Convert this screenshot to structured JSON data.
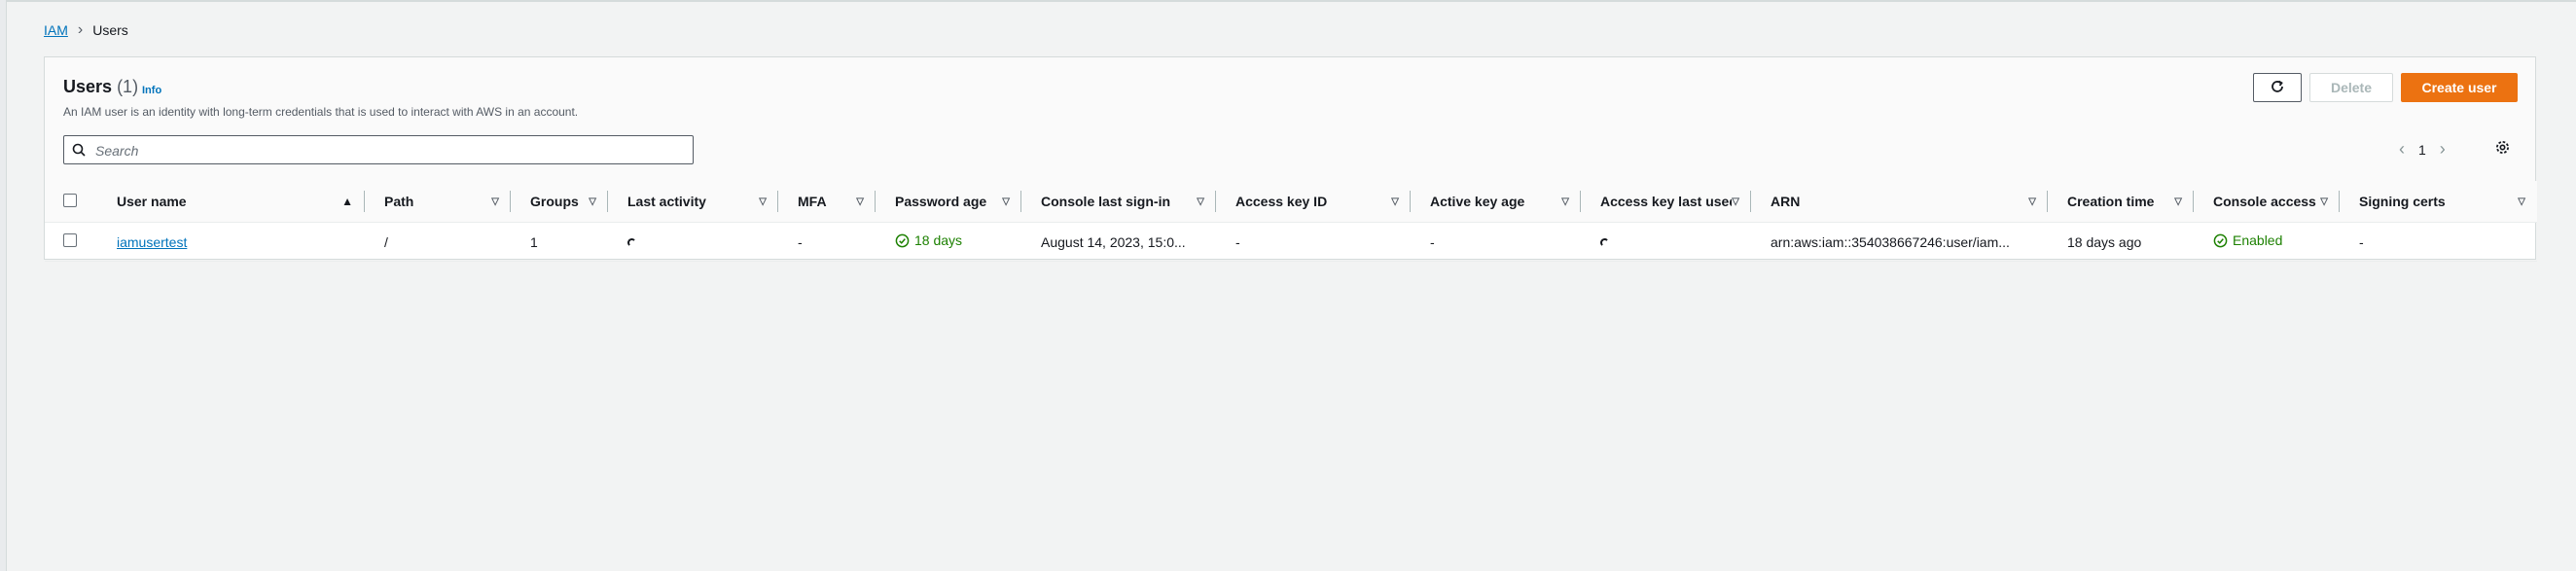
{
  "breadcrumb": {
    "root": "IAM",
    "current": "Users"
  },
  "panel": {
    "title": "Users",
    "count": "(1)",
    "info": "Info",
    "description": "An IAM user is an identity with long-term credentials that is used to interact with AWS in an account."
  },
  "search": {
    "placeholder": "Search",
    "value": ""
  },
  "actions": {
    "delete": "Delete",
    "create": "Create user"
  },
  "pagination": {
    "page": "1"
  },
  "table": {
    "columns": [
      "User name",
      "Path",
      "Groups",
      "Last activity",
      "MFA",
      "Password age",
      "Console last sign-in",
      "Access key ID",
      "Active key age",
      "Access key last used",
      "ARN",
      "Creation time",
      "Console access",
      "Signing certs"
    ],
    "rows": [
      {
        "user_name": "iamusertest",
        "path": "/",
        "groups": "1",
        "mfa": "-",
        "password_age": "18 days",
        "console_last_signin": "August 14, 2023, 15:0...",
        "access_key_id": "-",
        "active_key_age": "-",
        "arn": "arn:aws:iam::354038667246:user/iam...",
        "creation_time": "18 days ago",
        "console_access": "Enabled",
        "signing_certs": "-"
      }
    ]
  },
  "colors": {
    "accent": "#ec7211",
    "link": "#0073bb",
    "success": "#1d8102"
  }
}
